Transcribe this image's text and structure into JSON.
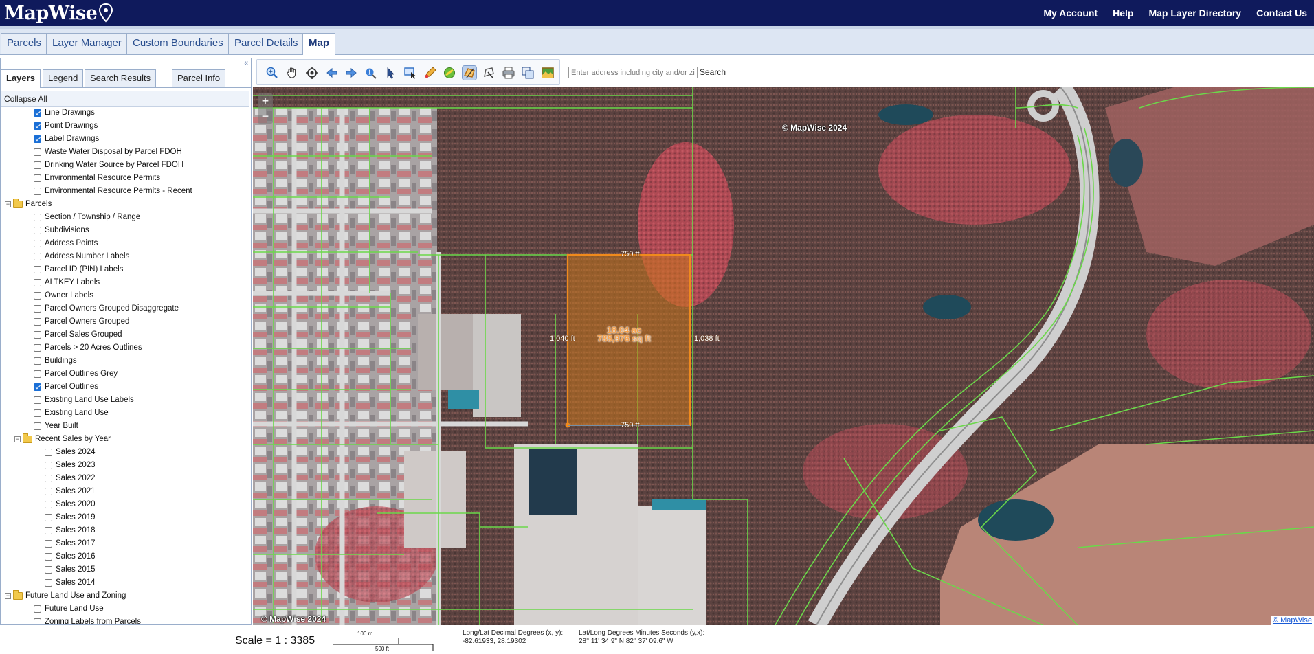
{
  "header": {
    "logo_text": "MapWise",
    "nav": [
      "My Account",
      "Help",
      "Map Layer Directory",
      "Contact Us"
    ]
  },
  "main_tabs": [
    "Parcels",
    "Layer Manager",
    "Custom Boundaries",
    "Parcel Details",
    "Map"
  ],
  "active_main_tab": "Map",
  "panel_tabs": [
    "Layers",
    "Legend",
    "Search Results",
    "Parcel Info"
  ],
  "active_panel_tab": "Layers",
  "collapse_all_label": "Collapse All",
  "layers": [
    {
      "label": "Line Drawings",
      "level": 2,
      "checked": true
    },
    {
      "label": "Point Drawings",
      "level": 2,
      "checked": true
    },
    {
      "label": "Label Drawings",
      "level": 2,
      "checked": true
    },
    {
      "label": "Waste Water Disposal by Parcel FDOH",
      "level": 2,
      "checked": false
    },
    {
      "label": "Drinking Water Source by Parcel FDOH",
      "level": 2,
      "checked": false
    },
    {
      "label": "Environmental Resource Permits",
      "level": 2,
      "checked": false
    },
    {
      "label": "Environmental Resource Permits - Recent",
      "level": 2,
      "checked": false
    },
    {
      "label": "Parcels",
      "level": 0,
      "folder": true
    },
    {
      "label": "Section / Township / Range",
      "level": 2,
      "checked": false
    },
    {
      "label": "Subdivisions",
      "level": 2,
      "checked": false
    },
    {
      "label": "Address Points",
      "level": 2,
      "checked": false
    },
    {
      "label": "Address Number Labels",
      "level": 2,
      "checked": false
    },
    {
      "label": "Parcel ID (PIN) Labels",
      "level": 2,
      "checked": false
    },
    {
      "label": "ALTKEY Labels",
      "level": 2,
      "checked": false
    },
    {
      "label": "Owner Labels",
      "level": 2,
      "checked": false
    },
    {
      "label": "Parcel Owners Grouped Disaggregate",
      "level": 2,
      "checked": false
    },
    {
      "label": "Parcel Owners Grouped",
      "level": 2,
      "checked": false
    },
    {
      "label": "Parcel Sales Grouped",
      "level": 2,
      "checked": false
    },
    {
      "label": "Parcels > 20 Acres Outlines",
      "level": 2,
      "checked": false
    },
    {
      "label": "Buildings",
      "level": 2,
      "checked": false
    },
    {
      "label": "Parcel Outlines Grey",
      "level": 2,
      "checked": false
    },
    {
      "label": "Parcel Outlines",
      "level": 2,
      "checked": true
    },
    {
      "label": "Existing Land Use Labels",
      "level": 2,
      "checked": false
    },
    {
      "label": "Existing Land Use",
      "level": 2,
      "checked": false
    },
    {
      "label": "Year Built",
      "level": 2,
      "checked": false
    },
    {
      "label": "Recent Sales by Year",
      "level": 1,
      "folder": true
    },
    {
      "label": "Sales 2024",
      "level": 3,
      "checked": false
    },
    {
      "label": "Sales 2023",
      "level": 3,
      "checked": false
    },
    {
      "label": "Sales 2022",
      "level": 3,
      "checked": false
    },
    {
      "label": "Sales 2021",
      "level": 3,
      "checked": false
    },
    {
      "label": "Sales 2020",
      "level": 3,
      "checked": false
    },
    {
      "label": "Sales 2019",
      "level": 3,
      "checked": false
    },
    {
      "label": "Sales 2018",
      "level": 3,
      "checked": false
    },
    {
      "label": "Sales 2017",
      "level": 3,
      "checked": false
    },
    {
      "label": "Sales 2016",
      "level": 3,
      "checked": false
    },
    {
      "label": "Sales 2015",
      "level": 3,
      "checked": false
    },
    {
      "label": "Sales 2014",
      "level": 3,
      "checked": false
    },
    {
      "label": "Future Land Use and Zoning",
      "level": 0,
      "folder": true
    },
    {
      "label": "Future Land Use",
      "level": 2,
      "checked": false
    },
    {
      "label": "Zoning Labels from Parcels",
      "level": 2,
      "checked": false
    }
  ],
  "toolbar": {
    "tools": [
      "zoom-in-icon",
      "pan-hand-icon",
      "locate-icon",
      "back-arrow-icon",
      "forward-arrow-icon",
      "info-icon",
      "select-arrow-icon",
      "select-box-icon",
      "draw-icon",
      "measure-icon",
      "measure-area-icon",
      "polygon-icon",
      "print-icon",
      "layers-copy-icon",
      "imagery-icon"
    ],
    "active_tool": "measure-area-icon",
    "address_placeholder": "Enter address including city and/or zipcode.",
    "search_label": "Search"
  },
  "map": {
    "watermark_top": "© MapWise 2024",
    "watermark_bottom": "© MapWise 2024",
    "copyright_link": "© MapWise",
    "measure": {
      "top_length": "750 ft",
      "bottom_length": "750 ft",
      "left_length": "1,040 ft",
      "right_length": "1,038 ft",
      "area_acres": "18.04 ac",
      "area_sqft": "785,976 sq ft"
    },
    "zoom_in": "+",
    "zoom_out": "−",
    "colors": {
      "measure_fill": "#c8761c",
      "measure_stroke": "#f08a1c",
      "parcel_line": "#6bd84a"
    }
  },
  "status": {
    "scale_text": "Scale = 1 : 3385",
    "scalebar_m": "100 m",
    "scalebar_ft": "500 ft",
    "decimal_label": "Long/Lat Decimal Degrees (x, y):",
    "decimal_value": "-82.61933, 28.19302",
    "dms_label": "Lat/Long Degrees Minutes Seconds (y,x):",
    "dms_value": "28° 11' 34.9\" N 82° 37' 09.6\" W"
  }
}
